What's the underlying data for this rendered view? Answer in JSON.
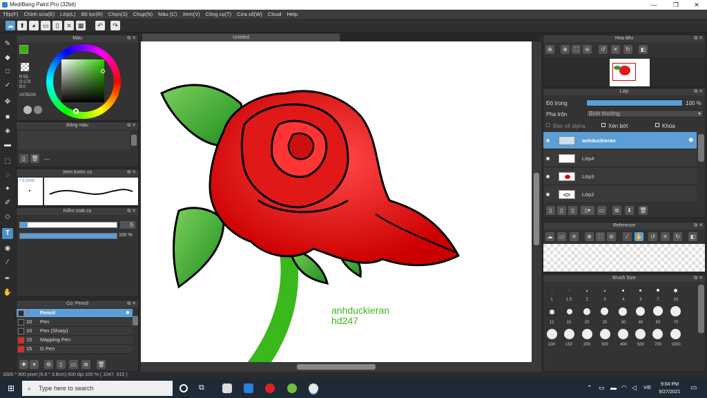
{
  "window": {
    "title": "MediBang Paint Pro (32bit)",
    "min": "—",
    "max": "❐",
    "close": "✕"
  },
  "menu": [
    "Tệp(F)",
    "Chỉnh sửa(E)",
    "Lớp(L)",
    "Bộ lọc(R)",
    "Chọn(S)",
    "Chụp(N)",
    "Màu (C)",
    "Xem(V)",
    "Công cụ(T)",
    "Cửa sổ(W)",
    "Cloud",
    "Help"
  ],
  "canvas": {
    "tab": "Untitled",
    "watermark_line1": "anhduckieran",
    "watermark_line2": "hd247"
  },
  "color_panel": {
    "title": "Màu",
    "r": "R:55",
    "g": "G:178",
    "b": "B:0",
    "hex": "#37B200",
    "fg": "#37b200",
    "bg": "#e8a020"
  },
  "palette_panel": {
    "title": "Bảng màu",
    "dash": "---"
  },
  "brush_preview": {
    "title": "Xem trước cọ",
    "size": "* 0.2mm"
  },
  "brush_control": {
    "title": "Kiểm soát cọ",
    "size_value": "5",
    "opacity_value": "100 %",
    "size_fill": 0.92,
    "opacity_fill": 1.0
  },
  "brush_list": {
    "title": "Cọ: Pencil",
    "items": [
      {
        "size": "5",
        "name": "Pencil",
        "color": "#2a2a2a",
        "sizecolor": "#e05050"
      },
      {
        "size": "10",
        "name": "Pen",
        "color": "#2a2a2a"
      },
      {
        "size": "10",
        "name": "Pen (Sharp)",
        "color": "#2a2a2a"
      },
      {
        "size": "15",
        "name": "Mapping Pen",
        "color": "#d03030"
      },
      {
        "size": "15",
        "name": "G Pen",
        "color": "#d03030"
      }
    ]
  },
  "navigator": {
    "title": "Hoa tiêu"
  },
  "layers_panel": {
    "title": "Lớp",
    "opacity_label": "Độ trong",
    "opacity_value": "100 %",
    "opacity_fill": 1.0,
    "blend_label": "Pha trộn",
    "blend_value": "Bình thường",
    "protect_alpha": "Bảo vệ alpha",
    "clipping": "Xén bớt",
    "lock": "Khóa",
    "layers": [
      {
        "name": "anhduckieran",
        "selected": true
      },
      {
        "name": "Lớp4",
        "selected": false
      },
      {
        "name": "Lớp3",
        "selected": false
      },
      {
        "name": "Lớp2",
        "selected": false
      }
    ]
  },
  "reference_panel": {
    "title": "Reference"
  },
  "brush_size_panel": {
    "title": "Brush Size",
    "row1": [
      "1",
      "1.5",
      "2",
      "3",
      "4",
      "5",
      "7",
      "10"
    ],
    "row2": [
      "12",
      "15",
      "20",
      "25",
      "30",
      "40",
      "50",
      "70"
    ],
    "row3": [
      "100",
      "150",
      "200",
      "300",
      "400",
      "500",
      "700",
      "1000"
    ]
  },
  "status": {
    "text": "1600 * 900 pixel   (6.8 * 3.8cm)   600 dpi   100 %   ( 1047, 615 )"
  },
  "taskbar": {
    "search_placeholder": "Type here to search",
    "time": "9:04 PM",
    "date": "9/27/2021",
    "lang": "VIE"
  }
}
